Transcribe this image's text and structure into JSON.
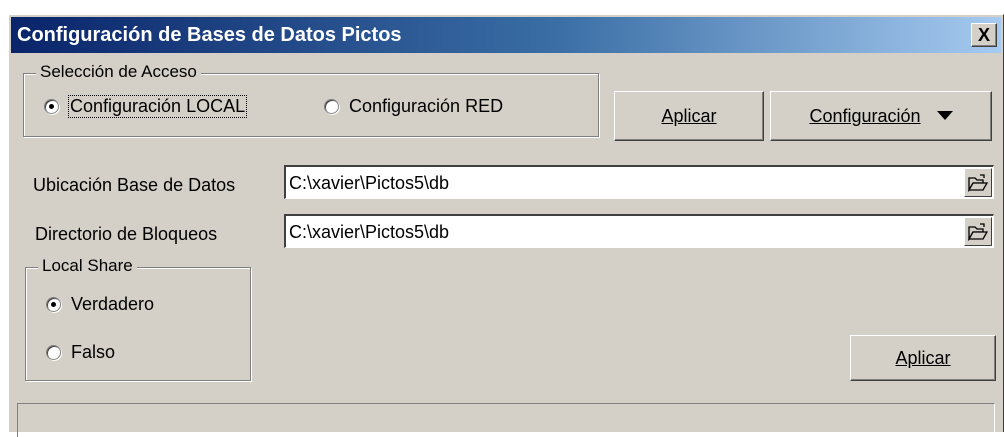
{
  "window": {
    "title": "Configuración de Bases de Datos Pictos",
    "close_label": "X"
  },
  "access": {
    "legend": "Selección de Acceso",
    "options": [
      {
        "label": "Configuración LOCAL",
        "checked": true
      },
      {
        "label": "Configuración RED",
        "checked": false
      }
    ]
  },
  "buttons": {
    "apply_top": "Aplicar",
    "config": "Configuración",
    "apply_bottom": "Aplicar"
  },
  "fields": {
    "db_location": {
      "label": "Ubicación Base de Datos",
      "value": "C:\\xavier\\Pictos5\\db"
    },
    "lock_dir": {
      "label": "Directorio de Bloqueos",
      "value": "C:\\xavier\\Pictos5\\db"
    }
  },
  "local_share": {
    "legend": "Local Share",
    "options": [
      {
        "label": "Verdadero",
        "checked": true
      },
      {
        "label": "Falso",
        "checked": false
      }
    ]
  },
  "icons": {
    "close": "close-icon",
    "folder": "open-folder-icon",
    "dropdown": "triangle-down-icon"
  },
  "colors": {
    "titlebar_start": "#0a246a",
    "titlebar_end": "#a6caf0",
    "face": "#d4d0c8"
  }
}
